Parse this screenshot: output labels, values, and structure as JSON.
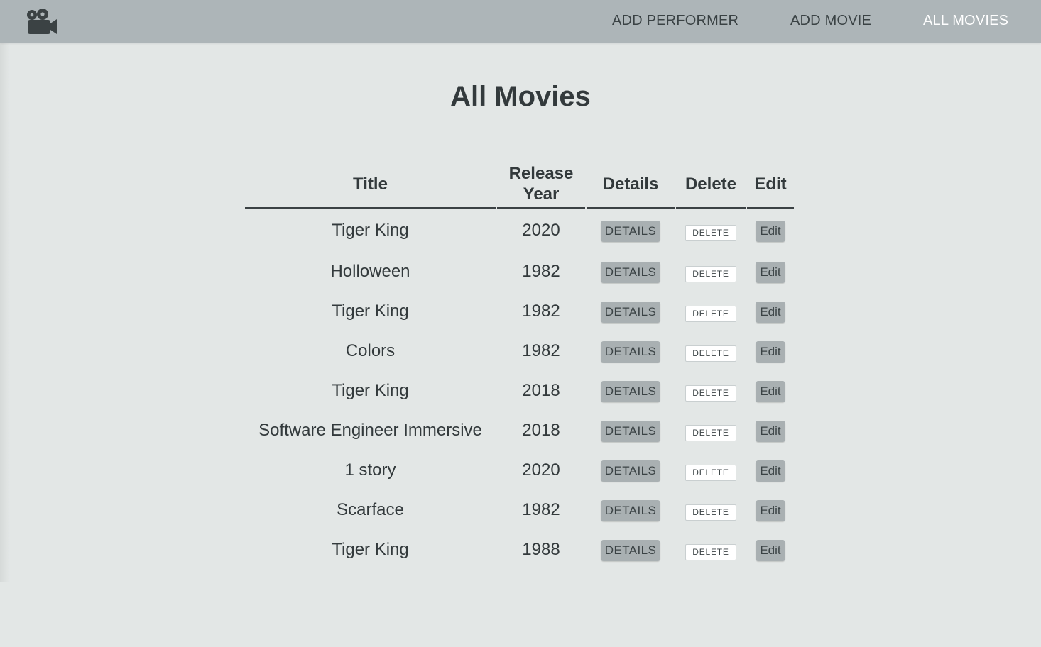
{
  "nav": {
    "logo_icon": "movie-camera-icon",
    "links": [
      {
        "label": "ADD PERFORMER",
        "active": false
      },
      {
        "label": "ADD MOVIE",
        "active": false
      },
      {
        "label": "ALL MOVIES",
        "active": true
      }
    ]
  },
  "page": {
    "title": "All Movies"
  },
  "table": {
    "headers": {
      "title": "Title",
      "release_year_line1": "Release",
      "release_year_line2": "Year",
      "details": "Details",
      "delete": "Delete",
      "edit": "Edit"
    },
    "rows": [
      {
        "title": "Tiger King",
        "year": "2020",
        "details": "DETAILS",
        "delete": "DELETE",
        "edit": "Edit"
      },
      {
        "title": "Holloween",
        "year": "1982",
        "details": "DETAILS",
        "delete": "DELETE",
        "edit": "Edit"
      },
      {
        "title": "Tiger King",
        "year": "1982",
        "details": "DETAILS",
        "delete": "DELETE",
        "edit": "Edit"
      },
      {
        "title": "Colors",
        "year": "1982",
        "details": "DETAILS",
        "delete": "DELETE",
        "edit": "Edit"
      },
      {
        "title": "Tiger King",
        "year": "2018",
        "details": "DETAILS",
        "delete": "DELETE",
        "edit": "Edit"
      },
      {
        "title": "Software Engineer Immersive",
        "year": "2018",
        "details": "DETAILS",
        "delete": "DELETE",
        "edit": "Edit"
      },
      {
        "title": "1 story",
        "year": "2020",
        "details": "DETAILS",
        "delete": "DELETE",
        "edit": "Edit"
      },
      {
        "title": "Scarface",
        "year": "1982",
        "details": "DETAILS",
        "delete": "DELETE",
        "edit": "Edit"
      },
      {
        "title": "Tiger King",
        "year": "1988",
        "details": "DETAILS",
        "delete": "DELETE",
        "edit": "Edit"
      }
    ]
  },
  "colors": {
    "navbar_bg": "#adb5b8",
    "page_bg": "#e3e7e6",
    "text": "#333a3c",
    "active_link": "#ffffff",
    "button_bg": "#a9b0b2"
  }
}
